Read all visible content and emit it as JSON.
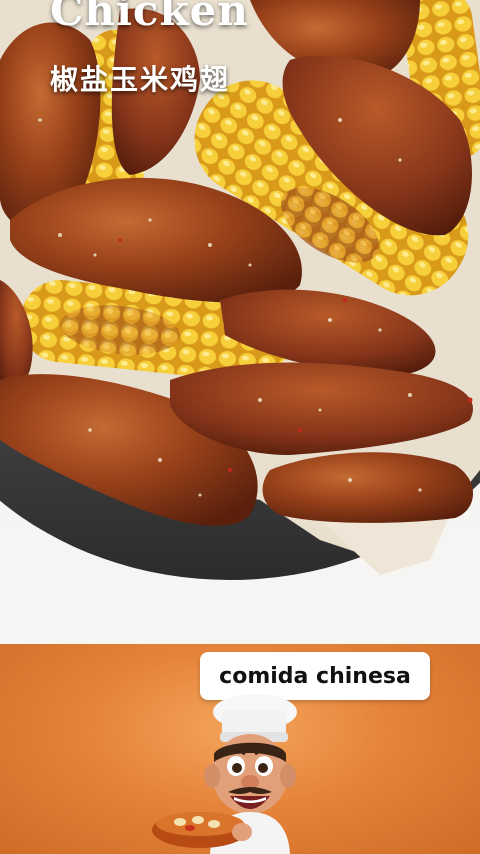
{
  "photo": {
    "title_en": "Chicken",
    "title_cn": "椒盐玉米鸡翅",
    "image": "food-photo: salt-and-pepper fried chicken wings with grilled corn cobs in a metal bowl"
  },
  "promo": {
    "caption": "comida chinesa",
    "mascot": "chef-cartoon-icon holding a bowl of food"
  },
  "colors": {
    "promo_orange": "#e6833a",
    "caption_bg": "#ffffff",
    "wing_brown": "#8a3716",
    "corn_yellow": "#f2c12e"
  }
}
